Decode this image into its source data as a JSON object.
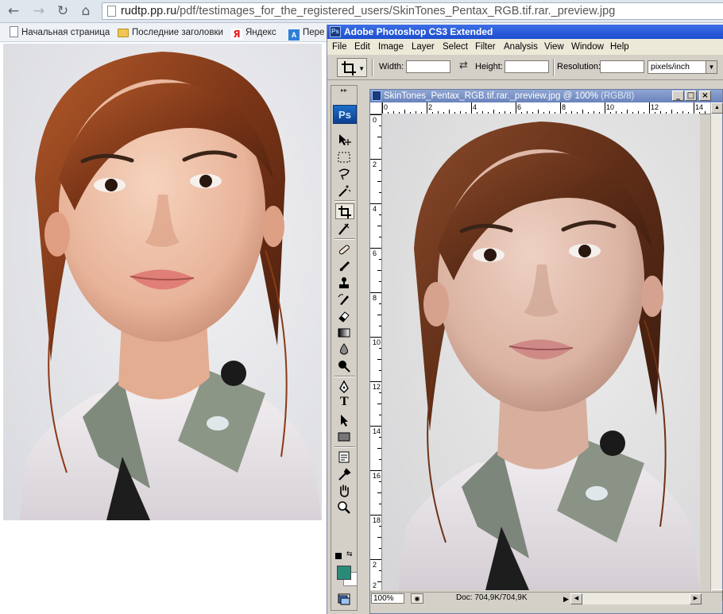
{
  "browser": {
    "nav": {
      "back": "←",
      "forward": "→",
      "reload": "↻",
      "home": "⌂"
    },
    "url_domain": "rudtp.pp.ru",
    "url_path": "/pdf/testimages_for_the_registered_users/SkinTones_Pentax_RGB.tif.rar._preview.jpg",
    "bookmarks": [
      {
        "label": "Начальная страница",
        "icon": "page-icon"
      },
      {
        "label": "Последние заголовки",
        "icon": "folder-icon"
      },
      {
        "label": "Яндекс",
        "icon": "yandex-icon",
        "glyph": "Я"
      },
      {
        "label": "Пере",
        "icon": "translate-icon",
        "glyph": "A"
      }
    ]
  },
  "photoshop": {
    "app_title": "Adobe Photoshop CS3 Extended",
    "logo": "Ps",
    "menus": [
      "File",
      "Edit",
      "Image",
      "Layer",
      "Select",
      "Filter",
      "Analysis",
      "View",
      "Window",
      "Help"
    ],
    "options": {
      "width_label": "Width:",
      "height_label": "Height:",
      "resolution_label": "Resolution:",
      "units_value": "pixels/inch"
    },
    "toolbox": {
      "grip": "▸▸",
      "tools": [
        "move-tool-icon",
        "marquee-tool-icon",
        "lasso-tool-icon",
        "magic-wand-tool-icon",
        "crop-tool-icon",
        "slice-tool-icon",
        "healing-brush-tool-icon",
        "brush-tool-icon",
        "clone-stamp-tool-icon",
        "history-brush-tool-icon",
        "eraser-tool-icon",
        "gradient-tool-icon",
        "blur-tool-icon",
        "dodge-tool-icon",
        "pen-tool-icon",
        "type-tool-icon",
        "path-selection-tool-icon",
        "rectangle-tool-icon",
        "notes-tool-icon",
        "eyedropper-tool-icon",
        "hand-tool-icon",
        "zoom-tool-icon",
        "quick-mask-icon",
        "screen-mode-icon"
      ],
      "type_glyph": "T",
      "foreground_color": "#2a8a78",
      "background_color": "#ffffff"
    },
    "document": {
      "title": "SkinTones_Pentax_RGB.tif.rar._preview.jpg @ 100%",
      "title_mode": "(RGB/8)",
      "controls": {
        "minimize": "_",
        "maximize": "□",
        "close": "×"
      },
      "ruler_h": [
        "0",
        "2",
        "4",
        "6",
        "8",
        "10",
        "12",
        "14"
      ],
      "ruler_v": [
        "0",
        "2",
        "4",
        "6",
        "8",
        "10",
        "12",
        "14",
        "16",
        "18",
        "2",
        "2"
      ],
      "zoom": "100%",
      "doc_info": "Doc: 704,9K/704,9K",
      "status_arrow": "▶",
      "scroll_left": "◀",
      "scroll_right": "▶",
      "scroll_up": "▲",
      "scroll_down": "▼"
    }
  }
}
